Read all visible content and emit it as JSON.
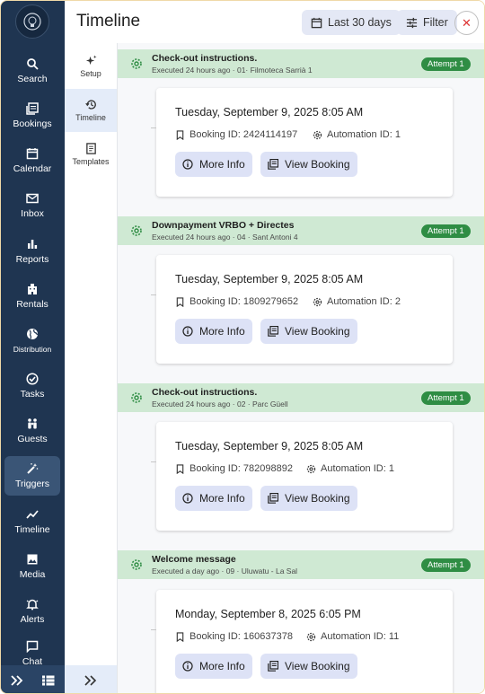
{
  "header": {
    "title": "Timeline",
    "date_range_label": "Last 30 days",
    "filter_label": "Filter"
  },
  "sidebar": {
    "items": [
      {
        "label": "Search",
        "icon": "search-icon"
      },
      {
        "label": "Bookings",
        "icon": "bookings-icon"
      },
      {
        "label": "Calendar",
        "icon": "calendar-icon"
      },
      {
        "label": "Inbox",
        "icon": "inbox-icon"
      },
      {
        "label": "Reports",
        "icon": "reports-icon"
      },
      {
        "label": "Rentals",
        "icon": "rentals-icon"
      },
      {
        "label": "Distribution",
        "icon": "globe-icon"
      },
      {
        "label": "Tasks",
        "icon": "tasks-icon"
      },
      {
        "label": "Guests",
        "icon": "guests-icon"
      },
      {
        "label": "Triggers",
        "icon": "wand-icon",
        "active": true
      },
      {
        "label": "Timeline",
        "icon": "trend-icon"
      },
      {
        "label": "Media",
        "icon": "image-icon"
      },
      {
        "label": "Alerts",
        "icon": "bell-icon"
      },
      {
        "label": "Chat",
        "icon": "chat-icon"
      }
    ]
  },
  "subnav": {
    "items": [
      {
        "label": "Setup",
        "icon": "sparkle-icon"
      },
      {
        "label": "Timeline",
        "icon": "history-icon",
        "active": true
      },
      {
        "label": "Templates",
        "icon": "document-icon"
      }
    ]
  },
  "buttons": {
    "more_info": "More Info",
    "view_booking": "View Booking"
  },
  "entries": [
    {
      "title": "Check-out instructions.",
      "subtitle": "Executed 24 hours ago · 01· Filmoteca Sarrià 1",
      "attempt": "Attempt 1",
      "date": "Tuesday, September 9, 2025 8:05 AM",
      "booking_id": "Booking ID: 2424114197",
      "automation_id": "Automation ID: 1"
    },
    {
      "title": "Downpayment VRBO + Directes",
      "subtitle": "Executed 24 hours ago · 04 · Sant Antoni 4",
      "attempt": "Attempt 1",
      "date": "Tuesday, September 9, 2025 8:05 AM",
      "booking_id": "Booking ID: 1809279652",
      "automation_id": "Automation ID: 2"
    },
    {
      "title": "Check-out instructions.",
      "subtitle": "Executed 24 hours ago · 02 · Parc Güell",
      "attempt": "Attempt 1",
      "date": "Tuesday, September 9, 2025 8:05 AM",
      "booking_id": "Booking ID: 782098892",
      "automation_id": "Automation ID: 1"
    },
    {
      "title": "Welcome message",
      "subtitle": "Executed a day ago · 09 · Uluwatu - La Sal",
      "attempt": "Attempt 1",
      "date": "Monday, September 8, 2025 6:05 PM",
      "booking_id": "Booking ID: 160637378",
      "automation_id": "Automation ID: 11"
    }
  ],
  "colors": {
    "sidebar": "#1f3551",
    "entry_header": "#cfe9d3",
    "attempt_badge": "#2f8d44",
    "button_bg": "#dde2f6",
    "close": "#dd3333"
  }
}
